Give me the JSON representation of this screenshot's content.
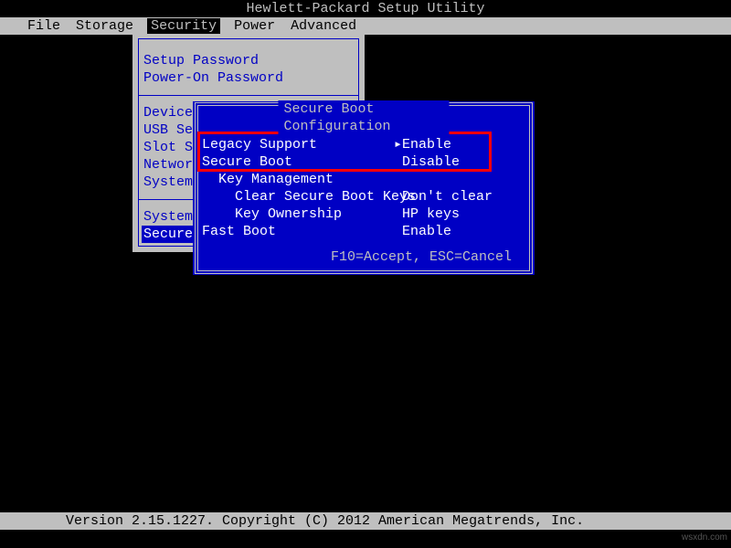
{
  "title": "Hewlett-Packard Setup Utility",
  "menubar": {
    "items": [
      "File",
      "Storage",
      "Security",
      "Power",
      "Advanced"
    ],
    "selected_index": 2
  },
  "security_menu": {
    "items_a": [
      "Setup Password",
      "Power-On Password"
    ],
    "items_b": [
      "Device Security",
      "USB Security",
      "Slot Security",
      "Network Boot",
      "System Security"
    ],
    "items_c": [
      "System IDs"
    ],
    "selected": "Secure Boot Configuration"
  },
  "dialog": {
    "title": " Secure Boot Configuration ",
    "rows": [
      {
        "label": "Legacy Support",
        "value": "Enable",
        "cursor": true
      },
      {
        "label": "Secure Boot",
        "value": "Disable",
        "cursor": false
      },
      {
        "label": "  Key Management",
        "value": "",
        "cursor": false
      },
      {
        "label": "    Clear Secure Boot Keys",
        "value": "Don't clear",
        "cursor": false
      },
      {
        "label": "    Key Ownership",
        "value": "HP keys",
        "cursor": false
      },
      {
        "label": "Fast Boot",
        "value": "Enable",
        "cursor": false
      }
    ],
    "footer": " F10=Accept, ESC=Cancel "
  },
  "statusbar": "Version 2.15.1227. Copyright (C) 2012 American Megatrends, Inc.",
  "watermark": "wsxdn.com"
}
